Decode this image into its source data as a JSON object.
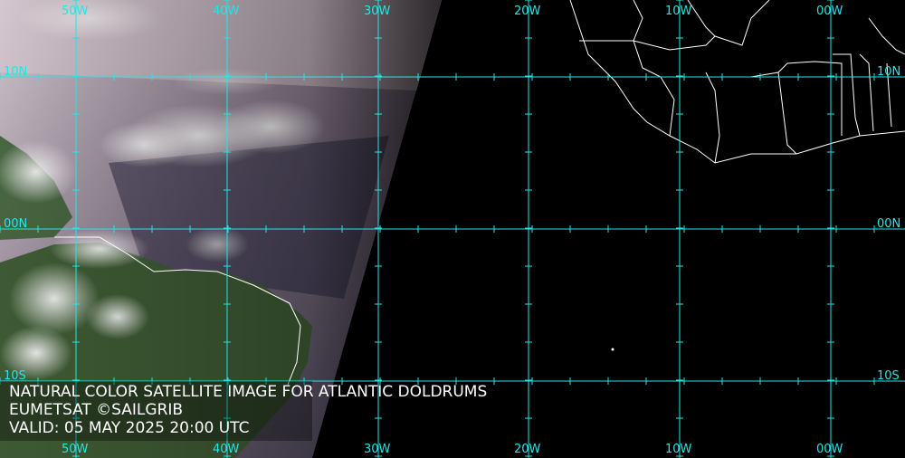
{
  "map": {
    "caption_title": "NATURAL COLOR SATELLITE IMAGE FOR ATLANTIC DOLDRUMS",
    "caption_credit": "EUMETSAT ©SAILGRIB",
    "caption_valid": "VALID:  05 MAY 2025 20:00 UTC",
    "lon_labels_top": [
      "50W",
      "40W",
      "30W",
      "20W",
      "10W",
      "00W"
    ],
    "lon_labels_bottom": [
      "50W",
      "40W",
      "30W",
      "20W",
      "10W",
      "00W"
    ],
    "lat_labels_left": [
      "10N",
      "00N",
      "10S"
    ],
    "lat_labels_right": [
      "10N",
      "00N",
      "10S"
    ],
    "grid_color": "#22e6e6",
    "text_color": "#ffffff",
    "night_color": "#000000",
    "land_outline_color": "#ffffff"
  }
}
